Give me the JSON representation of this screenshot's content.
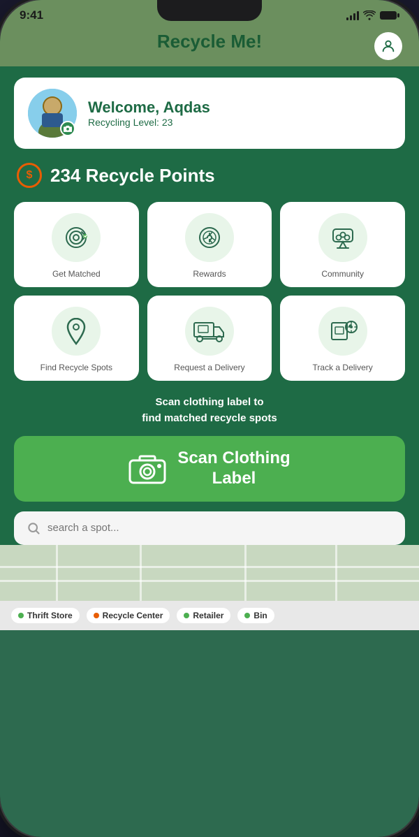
{
  "status": {
    "time": "9:41",
    "signal_label": "signal",
    "wifi_label": "wifi",
    "battery_label": "battery"
  },
  "header": {
    "title": "Recycle Me!",
    "profile_label": "profile"
  },
  "welcome": {
    "greeting": "Welcome, Aqdas",
    "level": "Recycling Level: 23"
  },
  "points": {
    "value": "234 Recycle Points",
    "icon_label": "$"
  },
  "grid_items": [
    {
      "label": "Get Matched",
      "icon": "fingerprint"
    },
    {
      "label": "Rewards",
      "icon": "rewards"
    },
    {
      "label": "Community",
      "icon": "community"
    },
    {
      "label": "Find Recycle Spots",
      "icon": "location"
    },
    {
      "label": "Request a Delivery",
      "icon": "delivery"
    },
    {
      "label": "Track a Delivery",
      "icon": "track"
    }
  ],
  "scan_section": {
    "description": "Scan clothing label to\nfind matched recycle spots",
    "button_label": "Scan Clothing\nLabel"
  },
  "search": {
    "placeholder": "search a spot..."
  },
  "map_tags": [
    {
      "label": "Thrift Store",
      "color": "#4caf50"
    },
    {
      "label": "Recycle Center",
      "color": "#e85d04"
    },
    {
      "label": "Retailer",
      "color": "#4caf50"
    },
    {
      "label": "Bin",
      "color": "#4caf50"
    }
  ]
}
